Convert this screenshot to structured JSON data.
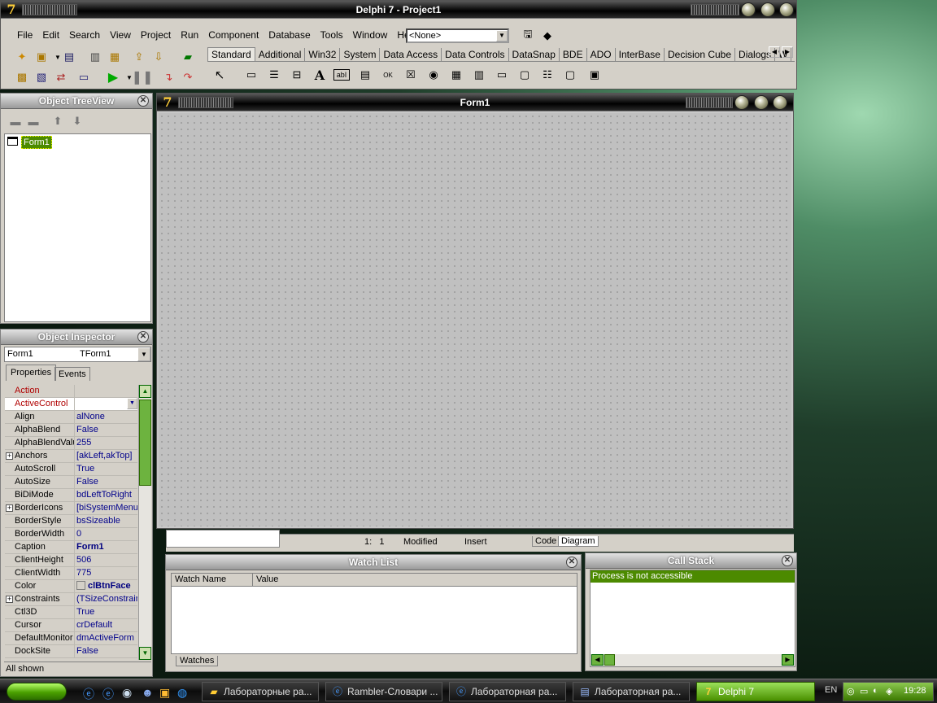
{
  "main_window": {
    "title": "Delphi 7 - Project1",
    "menu": [
      "File",
      "Edit",
      "Search",
      "View",
      "Project",
      "Run",
      "Component",
      "Database",
      "Tools",
      "Window",
      "Help"
    ],
    "desktop_combo": "<None>",
    "palette_tabs": [
      "Standard",
      "Additional",
      "Win32",
      "System",
      "Data Access",
      "Data Controls",
      "DataSnap",
      "BDE",
      "ADO",
      "InterBase",
      "Decision Cube",
      "Dialogs",
      "W"
    ]
  },
  "tree_view": {
    "title": "Object TreeView",
    "item": "Form1"
  },
  "inspector": {
    "title": "Object Inspector",
    "object_name": "Form1",
    "object_type": "TForm1",
    "tabs": [
      "Properties",
      "Events"
    ],
    "properties": [
      {
        "name": "Action",
        "value": "",
        "red": true
      },
      {
        "name": "ActiveControl",
        "value": "",
        "red": true,
        "selected": true
      },
      {
        "name": "Align",
        "value": "alNone"
      },
      {
        "name": "AlphaBlend",
        "value": "False"
      },
      {
        "name": "AlphaBlendValu",
        "value": "255"
      },
      {
        "name": "Anchors",
        "value": "[akLeft,akTop]",
        "plus": true
      },
      {
        "name": "AutoScroll",
        "value": "True"
      },
      {
        "name": "AutoSize",
        "value": "False"
      },
      {
        "name": "BiDiMode",
        "value": "bdLeftToRight"
      },
      {
        "name": "BorderIcons",
        "value": "[biSystemMenu,",
        "plus": true
      },
      {
        "name": "BorderStyle",
        "value": "bsSizeable"
      },
      {
        "name": "BorderWidth",
        "value": "0"
      },
      {
        "name": "Caption",
        "value": "Form1",
        "bold": true
      },
      {
        "name": "ClientHeight",
        "value": "506"
      },
      {
        "name": "ClientWidth",
        "value": "775"
      },
      {
        "name": "Color",
        "value": "clBtnFace",
        "bold": true,
        "swatch": true
      },
      {
        "name": "Constraints",
        "value": "(TSizeConstrain",
        "plus": true
      },
      {
        "name": "Ctl3D",
        "value": "True"
      },
      {
        "name": "Cursor",
        "value": "crDefault"
      },
      {
        "name": "DefaultMonitor",
        "value": "dmActiveForm"
      },
      {
        "name": "DockSite",
        "value": "False"
      }
    ],
    "status": "All shown"
  },
  "form": {
    "title": "Form1"
  },
  "editor_status": {
    "position": "1:   1",
    "modified": "Modified",
    "mode": "Insert",
    "tabs": [
      "Code",
      "Diagram"
    ]
  },
  "watch_list": {
    "title": "Watch List",
    "columns": [
      "Watch Name",
      "Value"
    ],
    "tab": "Watches"
  },
  "call_stack": {
    "title": "Call Stack",
    "message": "Process is not accessible"
  },
  "taskbar": {
    "items": [
      "Лабораторные ра...",
      "Rambler-Словари ...",
      "Лабораторная ра...",
      "Лабораторная ра...",
      "Delphi 7"
    ],
    "lang": "EN",
    "clock": "19:28"
  },
  "colors": {
    "selected_green": "#4c8a00",
    "taskbar_active": "#5aa000"
  }
}
